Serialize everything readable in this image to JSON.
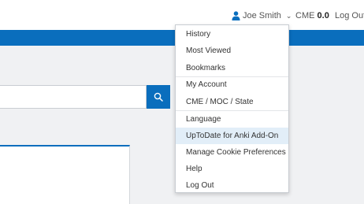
{
  "header": {
    "user_name": "Joe Smith",
    "cme_label": "CME",
    "cme_value": "0.0",
    "logout_label": "Log Out"
  },
  "search": {
    "placeholder": ""
  },
  "user_menu": {
    "items": [
      {
        "label": "History"
      },
      {
        "label": "Most Viewed"
      },
      {
        "label": "Bookmarks"
      },
      {
        "label": "My Account"
      },
      {
        "label": "CME / MOC / State"
      },
      {
        "label": "Language"
      },
      {
        "label": "UpToDate for Anki Add-On"
      },
      {
        "label": "Manage Cookie Preferences"
      },
      {
        "label": "Help"
      },
      {
        "label": "Log Out"
      }
    ]
  },
  "colors": {
    "brand_blue": "#0a6ebd",
    "highlight": "#e2eef8"
  },
  "icons": {
    "user": "user-icon",
    "chevron": "chevron-down-icon",
    "search": "search-icon"
  }
}
